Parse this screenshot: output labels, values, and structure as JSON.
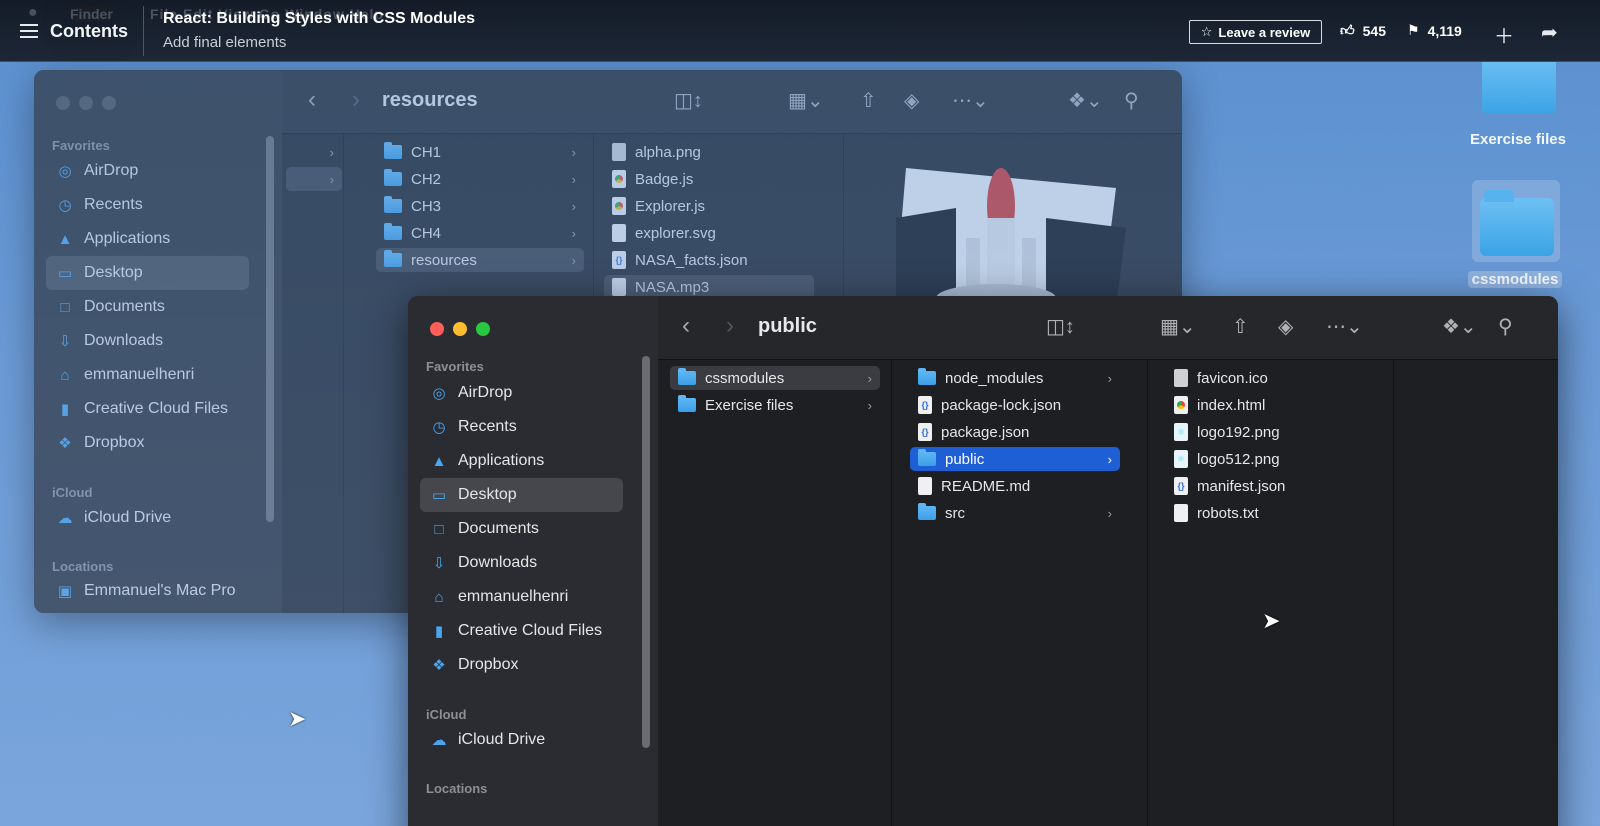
{
  "mac_menu": {
    "apple": "",
    "app": "Finder",
    "ghost": "File  Edit  View  Go  Window  Help"
  },
  "player": {
    "contents_label": "Contents",
    "course_title": "React: Building Styles with CSS Modules",
    "video_title": "Add final elements",
    "review_label": "Leave a review",
    "likes": "545",
    "saves": "4,119"
  },
  "desktop": {
    "items": [
      {
        "label": "Exercise files"
      },
      {
        "label": "cssmodules"
      }
    ]
  },
  "back_window": {
    "path": "resources",
    "sidebar": {
      "favorites_header": "Favorites",
      "items": [
        "AirDrop",
        "Recents",
        "Applications",
        "Desktop",
        "Documents",
        "Downloads",
        "emmanuelhenri",
        "Creative Cloud Files",
        "Dropbox"
      ],
      "icloud_header": "iCloud",
      "icloud_items": [
        "iCloud Drive"
      ],
      "locations_header": "Locations",
      "locations_items": [
        "Emmanuel's Mac Pro"
      ]
    },
    "col_folders": [
      "CH1",
      "CH2",
      "CH3",
      "CH4",
      "resources"
    ],
    "col_files": [
      "alpha.png",
      "Badge.js",
      "Explorer.js",
      "explorer.svg",
      "NASA_facts.json",
      "NASA.mp3"
    ]
  },
  "front_window": {
    "path": "public",
    "sidebar": {
      "favorites_header": "Favorites",
      "items": [
        "AirDrop",
        "Recents",
        "Applications",
        "Desktop",
        "Documents",
        "Downloads",
        "emmanuelhenri",
        "Creative Cloud Files",
        "Dropbox"
      ],
      "icloud_header": "iCloud",
      "icloud_items": [
        "iCloud Drive"
      ],
      "locations_header": "Locations"
    },
    "col1": [
      "cssmodules",
      "Exercise files"
    ],
    "col2": [
      "node_modules",
      "package-lock.json",
      "package.json",
      "public",
      "README.md",
      "src"
    ],
    "col3": [
      "favicon.ico",
      "index.html",
      "logo192.png",
      "logo512.png",
      "manifest.json",
      "robots.txt"
    ]
  },
  "colors": {
    "desktop_bg": "#6a9ad6",
    "selection_blue": "#1f5fd6",
    "folder_blue": "#3c9ee8"
  }
}
